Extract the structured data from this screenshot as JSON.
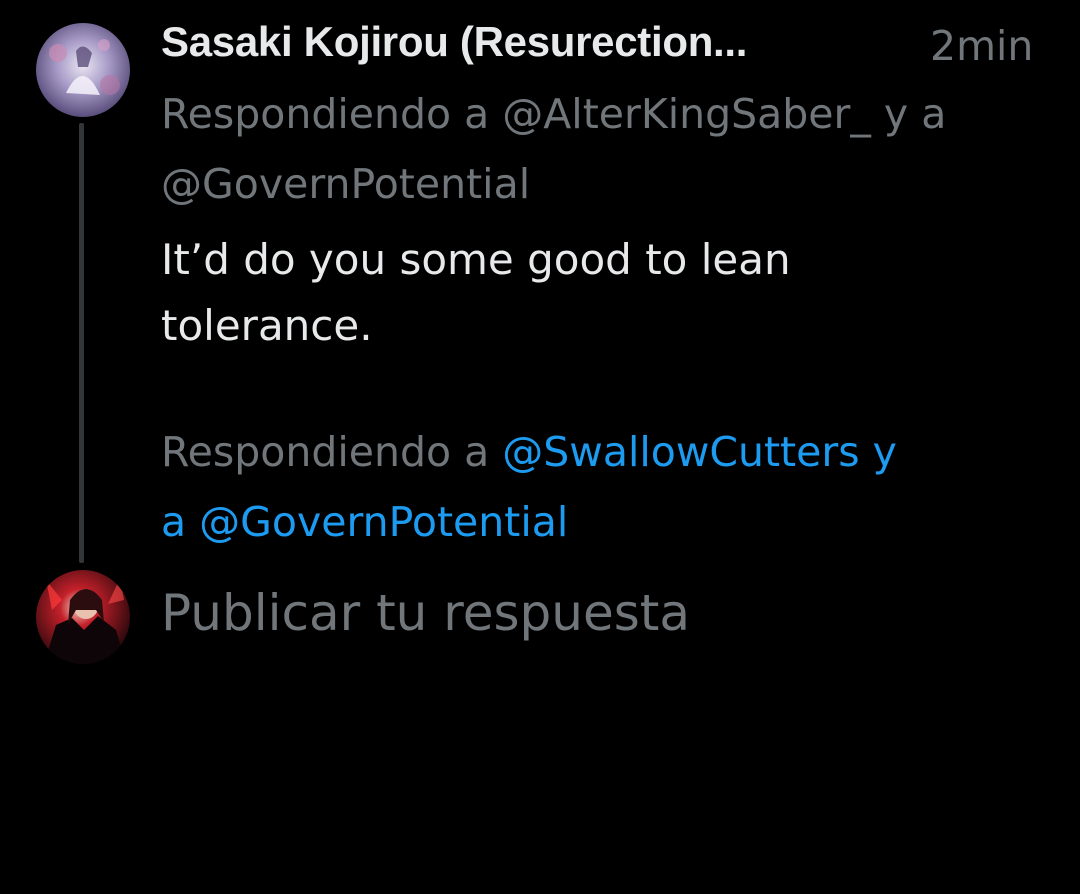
{
  "tweet": {
    "author_name": "Sasaki Kojirou (Resurection...",
    "timestamp": "2min",
    "replying_to_line1": "Respondiendo a @AlterKingSaber_ y a",
    "replying_to_line2": "@GovernPotential",
    "text_line1": "It’d do you some good to lean",
    "text_line2": "tolerance.",
    "avatar": "tweet-author-avatar"
  },
  "compose": {
    "replying_prefix": "Respondiendo a ",
    "mention_1": "@SwallowCutters y",
    "mention_2": "a @GovernPotential",
    "placeholder": "Publicar tu respuesta",
    "avatar": "current-user-avatar"
  },
  "colors": {
    "background": "#000000",
    "primary_text": "#e7e9ea",
    "secondary_text": "#71767b",
    "link": "#1d9bf0",
    "thread_line": "#333639"
  }
}
